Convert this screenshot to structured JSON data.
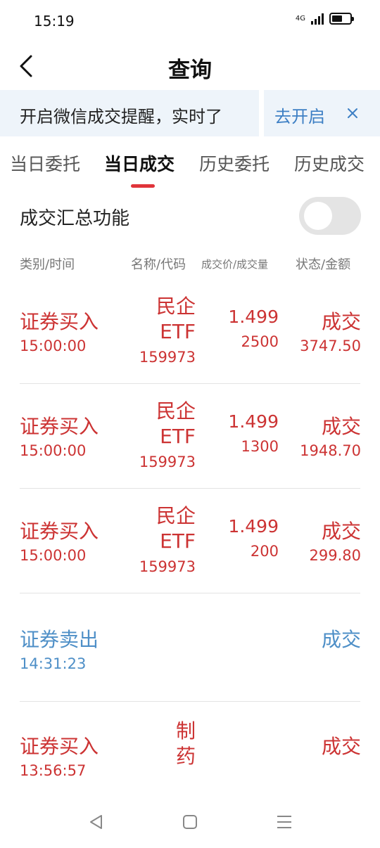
{
  "status_bar": {
    "time": "15:19",
    "signal_label": "4G"
  },
  "nav": {
    "title": "查询"
  },
  "banner": {
    "text": "开启微信成交提醒，实时了",
    "link": "去开启"
  },
  "tabs": [
    {
      "label": "当日委托"
    },
    {
      "label": "当日成交"
    },
    {
      "label": "历史委托"
    },
    {
      "label": "历史成交"
    }
  ],
  "active_tab_index": 1,
  "summary": {
    "label": "成交汇总功能",
    "toggle_on": false
  },
  "columns": {
    "type_time": "类别/时间",
    "name_code": "名称/代码",
    "price_qty": "成交价/成交量",
    "status_amount": "状态/金额"
  },
  "trades": [
    {
      "type": "证券买入",
      "time": "15:00:00",
      "name_line1": "民企",
      "name_line2": "ETF",
      "code": "159973",
      "price": "1.499",
      "qty": "2500",
      "status": "成交",
      "amount": "3747.50"
    },
    {
      "type": "证券买入",
      "time": "15:00:00",
      "name_line1": "民企",
      "name_line2": "ETF",
      "code": "159973",
      "price": "1.499",
      "qty": "1300",
      "status": "成交",
      "amount": "1948.70"
    },
    {
      "type": "证券买入",
      "time": "15:00:00",
      "name_line1": "民企",
      "name_line2": "ETF",
      "code": "159973",
      "price": "1.499",
      "qty": "200",
      "status": "成交",
      "amount": "299.80"
    },
    {
      "type": "证券卖出",
      "time": "14:31:23",
      "name_line1": "",
      "name_line2": "",
      "code": "",
      "price": "",
      "qty": "",
      "status": "成交",
      "amount": ""
    },
    {
      "type": "证券买入",
      "time": "13:56:57",
      "name_line1": "制",
      "name_line2": "药",
      "code": "",
      "price": "",
      "qty": "",
      "status": "成交",
      "amount": ""
    }
  ],
  "colors": {
    "buy": "#cc3333",
    "sell": "#4e8fc7",
    "accent": "#e0343a",
    "link": "#3d7fc4"
  }
}
